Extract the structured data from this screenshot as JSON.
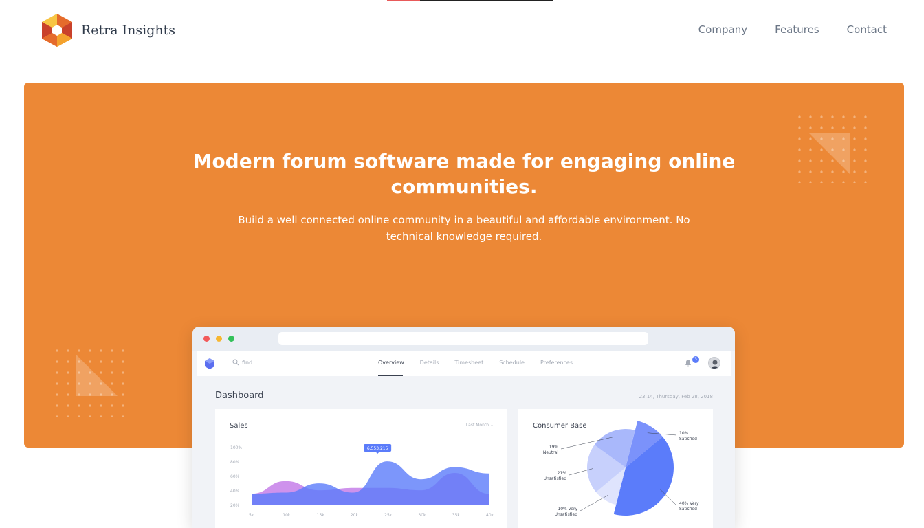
{
  "header": {
    "brand": "Retra Insights",
    "nav": [
      {
        "label": "Company"
      },
      {
        "label": "Features"
      },
      {
        "label": "Contact"
      }
    ]
  },
  "hero": {
    "title": "Modern forum software made for engaging online communities.",
    "subtitle": "Build a well connected online community in a beautiful and affordable environment. No technical knowledge required.",
    "bg_color": "#ec8836"
  },
  "dashboard": {
    "search_placeholder": "find..",
    "tabs": [
      "Overview",
      "Details",
      "Timesheet",
      "Schedule",
      "Preferences"
    ],
    "active_tab": "Overview",
    "notification_count": "3",
    "title": "Dashboard",
    "datetime": "23:14, Thursday, Feb 28, 2018",
    "sales": {
      "title": "Sales",
      "filter": "Last Month",
      "tooltip": "6,553,215"
    },
    "consumer": {
      "title": "Consumer Base"
    }
  },
  "chart_data": [
    {
      "type": "area",
      "title": "Sales",
      "x": [
        "5k",
        "10k",
        "15k",
        "20k",
        "25k",
        "30k",
        "35k",
        "40k"
      ],
      "y_ticks": [
        "100%",
        "80%",
        "60%",
        "40%",
        "20%"
      ],
      "series": [
        {
          "values": [
            20,
            42,
            26,
            30,
            30,
            26,
            56,
            20
          ]
        },
        {
          "values": [
            20,
            22,
            38,
            22,
            76,
            45,
            66,
            55
          ]
        }
      ],
      "ylim": [
        0,
        100
      ],
      "annotations": [
        {
          "x": "25k",
          "label": "6,553,215"
        }
      ]
    },
    {
      "type": "pie",
      "title": "Consumer Base",
      "slices": [
        {
          "label": "10%",
          "sublabel": "Satisfied",
          "value": 10
        },
        {
          "label": "40% Very",
          "sublabel": "Satisfied",
          "value": 40
        },
        {
          "label": "10% Very",
          "sublabel": "Unsatisfied",
          "value": 10
        },
        {
          "label": "21%",
          "sublabel": "Unsatisfied",
          "value": 21
        },
        {
          "label": "19%",
          "sublabel": "Neutral",
          "value": 19
        }
      ]
    }
  ]
}
